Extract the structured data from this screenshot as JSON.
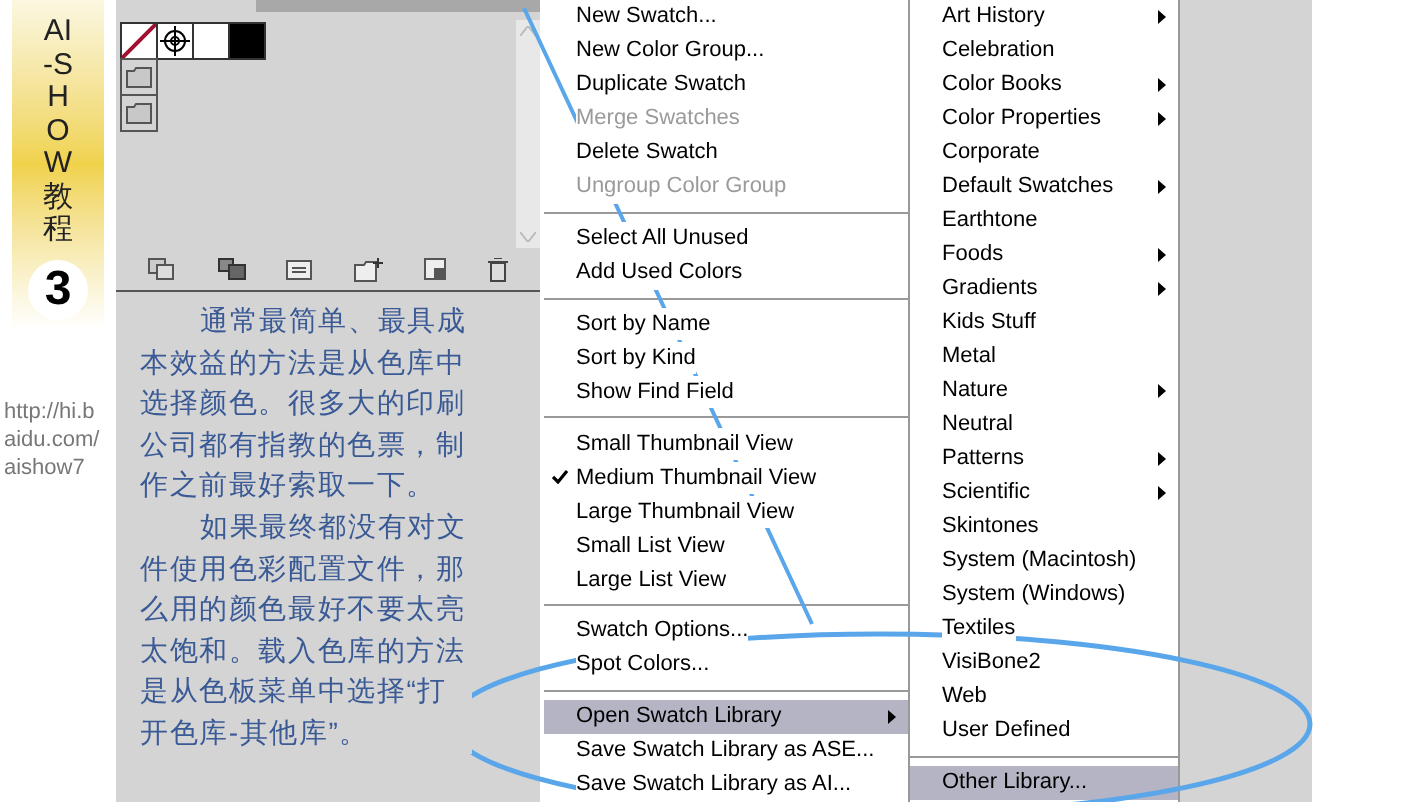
{
  "banner": {
    "title": "AI-SHOW教程",
    "number": "3"
  },
  "url_lines": [
    "http://hi.b",
    "aidu.com/",
    "aishow7"
  ],
  "swatches_panel": {
    "swatches": [
      {
        "kind": "none",
        "color": "#ffffff"
      },
      {
        "kind": "registration",
        "color": "#ffffff"
      },
      {
        "kind": "solid",
        "color": "#ffffff"
      },
      {
        "kind": "solid",
        "color": "#000000"
      }
    ],
    "groups": [
      {
        "kind": "folder"
      },
      {
        "kind": "folder"
      }
    ]
  },
  "paragraphs": [
    "通常最简单、最具成本效益的方法是从色库中选择颜色。很多大的印刷公司都有指教的色票，制作之前最好索取一下。",
    "如果最终都没有对文件使用色彩配置文件，那么用的颜色最好不要太亮太饱和。载入色库的方法是从色板菜单中选择“打开色库-其他库”。"
  ],
  "panel_menu": [
    {
      "kind": "item",
      "label": "New Swatch...",
      "disabled": false,
      "checked": false,
      "submenu": false,
      "selected": false
    },
    {
      "kind": "item",
      "label": "New Color Group...",
      "disabled": false,
      "checked": false,
      "submenu": false,
      "selected": false
    },
    {
      "kind": "item",
      "label": "Duplicate Swatch",
      "disabled": false,
      "checked": false,
      "submenu": false,
      "selected": false
    },
    {
      "kind": "item",
      "label": "Merge Swatches",
      "disabled": true,
      "checked": false,
      "submenu": false,
      "selected": false
    },
    {
      "kind": "item",
      "label": "Delete Swatch",
      "disabled": false,
      "checked": false,
      "submenu": false,
      "selected": false
    },
    {
      "kind": "item",
      "label": "Ungroup Color Group",
      "disabled": true,
      "checked": false,
      "submenu": false,
      "selected": false
    },
    {
      "kind": "separator"
    },
    {
      "kind": "item",
      "label": "Select All Unused",
      "disabled": false,
      "checked": false,
      "submenu": false,
      "selected": false
    },
    {
      "kind": "item",
      "label": "Add Used Colors",
      "disabled": false,
      "checked": false,
      "submenu": false,
      "selected": false
    },
    {
      "kind": "separator"
    },
    {
      "kind": "item",
      "label": "Sort by Name",
      "disabled": false,
      "checked": false,
      "submenu": false,
      "selected": false
    },
    {
      "kind": "item",
      "label": "Sort by Kind",
      "disabled": false,
      "checked": false,
      "submenu": false,
      "selected": false
    },
    {
      "kind": "item",
      "label": "Show Find Field",
      "disabled": false,
      "checked": false,
      "submenu": false,
      "selected": false
    },
    {
      "kind": "separator"
    },
    {
      "kind": "item",
      "label": "Small Thumbnail View",
      "disabled": false,
      "checked": false,
      "submenu": false,
      "selected": false
    },
    {
      "kind": "item",
      "label": "Medium Thumbnail View",
      "disabled": false,
      "checked": true,
      "submenu": false,
      "selected": false
    },
    {
      "kind": "item",
      "label": "Large Thumbnail View",
      "disabled": false,
      "checked": false,
      "submenu": false,
      "selected": false
    },
    {
      "kind": "item",
      "label": "Small List View",
      "disabled": false,
      "checked": false,
      "submenu": false,
      "selected": false
    },
    {
      "kind": "item",
      "label": "Large List View",
      "disabled": false,
      "checked": false,
      "submenu": false,
      "selected": false
    },
    {
      "kind": "separator"
    },
    {
      "kind": "item",
      "label": "Swatch Options...",
      "disabled": false,
      "checked": false,
      "submenu": false,
      "selected": false
    },
    {
      "kind": "item",
      "label": "Spot Colors...",
      "disabled": false,
      "checked": false,
      "submenu": false,
      "selected": false
    },
    {
      "kind": "separator"
    },
    {
      "kind": "item",
      "label": "Open Swatch Library",
      "disabled": false,
      "checked": false,
      "submenu": true,
      "selected": true
    },
    {
      "kind": "item",
      "label": "Save Swatch Library as ASE...",
      "disabled": false,
      "checked": false,
      "submenu": false,
      "selected": false
    },
    {
      "kind": "item",
      "label": "Save Swatch Library as AI...",
      "disabled": false,
      "checked": false,
      "submenu": false,
      "selected": false
    }
  ],
  "library_menu": [
    {
      "kind": "item",
      "label": "Art History",
      "submenu": true,
      "selected": false
    },
    {
      "kind": "item",
      "label": "Celebration",
      "submenu": false,
      "selected": false
    },
    {
      "kind": "item",
      "label": "Color Books",
      "submenu": true,
      "selected": false
    },
    {
      "kind": "item",
      "label": "Color Properties",
      "submenu": true,
      "selected": false
    },
    {
      "kind": "item",
      "label": "Corporate",
      "submenu": false,
      "selected": false
    },
    {
      "kind": "item",
      "label": "Default Swatches",
      "submenu": true,
      "selected": false
    },
    {
      "kind": "item",
      "label": "Earthtone",
      "submenu": false,
      "selected": false
    },
    {
      "kind": "item",
      "label": "Foods",
      "submenu": true,
      "selected": false
    },
    {
      "kind": "item",
      "label": "Gradients",
      "submenu": true,
      "selected": false
    },
    {
      "kind": "item",
      "label": "Kids Stuff",
      "submenu": false,
      "selected": false
    },
    {
      "kind": "item",
      "label": "Metal",
      "submenu": false,
      "selected": false
    },
    {
      "kind": "item",
      "label": "Nature",
      "submenu": true,
      "selected": false
    },
    {
      "kind": "item",
      "label": "Neutral",
      "submenu": false,
      "selected": false
    },
    {
      "kind": "item",
      "label": "Patterns",
      "submenu": true,
      "selected": false
    },
    {
      "kind": "item",
      "label": "Scientific",
      "submenu": true,
      "selected": false
    },
    {
      "kind": "item",
      "label": "Skintones",
      "submenu": false,
      "selected": false
    },
    {
      "kind": "item",
      "label": "System (Macintosh)",
      "submenu": false,
      "selected": false
    },
    {
      "kind": "item",
      "label": "System (Windows)",
      "submenu": false,
      "selected": false
    },
    {
      "kind": "item",
      "label": "Textiles",
      "submenu": false,
      "selected": false
    },
    {
      "kind": "item",
      "label": "VisiBone2",
      "submenu": false,
      "selected": false
    },
    {
      "kind": "item",
      "label": "Web",
      "submenu": false,
      "selected": false
    },
    {
      "kind": "item",
      "label": "User Defined",
      "submenu": false,
      "selected": false
    },
    {
      "kind": "separator"
    },
    {
      "kind": "item",
      "label": "Other Library...",
      "submenu": false,
      "selected": true
    }
  ]
}
